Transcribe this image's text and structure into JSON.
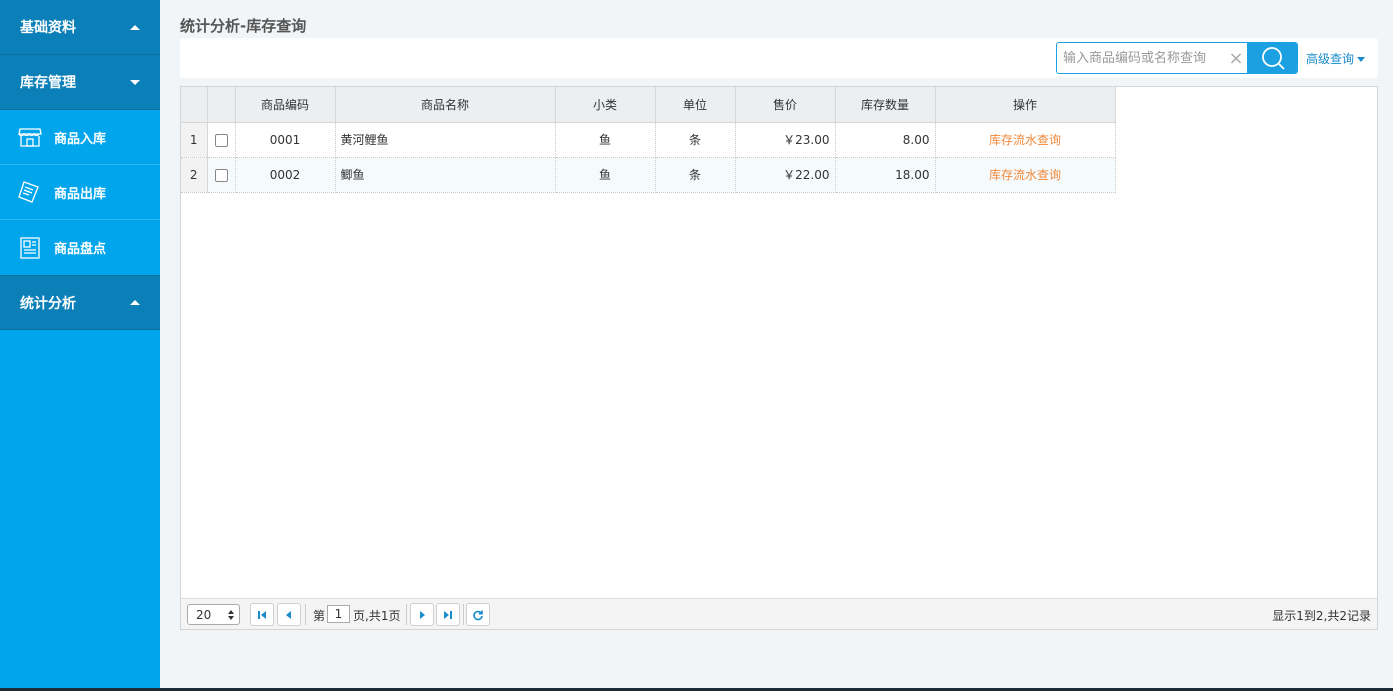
{
  "sidebar": {
    "groups": [
      {
        "label": "基础资料"
      },
      {
        "label": "库存管理"
      },
      {
        "label": "统计分析"
      }
    ],
    "items": [
      {
        "label": "商品入库",
        "icon": "store-icon"
      },
      {
        "label": "商品出库",
        "icon": "receipt-icon"
      },
      {
        "label": "商品盘点",
        "icon": "clipboard-icon"
      }
    ]
  },
  "page": {
    "title": "统计分析-库存查询"
  },
  "search": {
    "placeholder": "输入商品编码或名称查询",
    "clear_glyph": "×",
    "advanced_label": "高级查询"
  },
  "table": {
    "columns": [
      "商品编码",
      "商品名称",
      "小类",
      "单位",
      "售价",
      "库存数量",
      "操作"
    ],
    "rows": [
      {
        "rownum": "1",
        "code": "0001",
        "name": "黄河鲤鱼",
        "category": "鱼",
        "unit": "条",
        "price": "￥23.00",
        "qty": "8.00",
        "action": "库存流水查询"
      },
      {
        "rownum": "2",
        "code": "0002",
        "name": "鲫鱼",
        "category": "鱼",
        "unit": "条",
        "price": "￥22.00",
        "qty": "18.00",
        "action": "库存流水查询"
      }
    ]
  },
  "pager": {
    "page_size": "20",
    "page_prefix": "第",
    "current_page": "1",
    "page_suffix": "页,共1页",
    "info": "显示1到2,共2记录"
  },
  "colors": {
    "sidebar_bg": "#00a5ec",
    "group_header_bg": "#0b7fb7",
    "accent": "#1ba1e2",
    "action_link": "#f0883a"
  }
}
